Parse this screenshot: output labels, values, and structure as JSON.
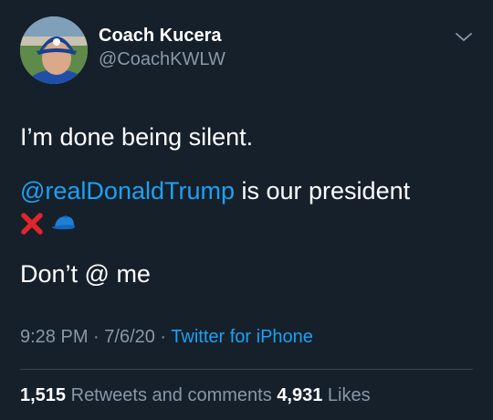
{
  "author": {
    "display_name": "Coach Kucera",
    "handle": "@CoachKWLW"
  },
  "tweet": {
    "line1": "I’m done being silent.",
    "mention": "@realDonaldTrump",
    "line2_rest": " is our president",
    "emojis": [
      "cross-mark-icon",
      "blue-cap-icon"
    ],
    "line3": "Don’t @ me"
  },
  "meta": {
    "time": "9:28 PM",
    "sep1": " · ",
    "date": "7/6/20",
    "sep2": " · ",
    "source": "Twitter for iPhone"
  },
  "stats": {
    "retweets_count": "1,515",
    "retweets_label": " Retweets and comments ",
    "likes_count": "4,931",
    "likes_label": " Likes"
  },
  "colors": {
    "background": "#15202b",
    "link": "#1da1f2",
    "secondary_text": "#8899a6",
    "divider": "#38444d"
  }
}
